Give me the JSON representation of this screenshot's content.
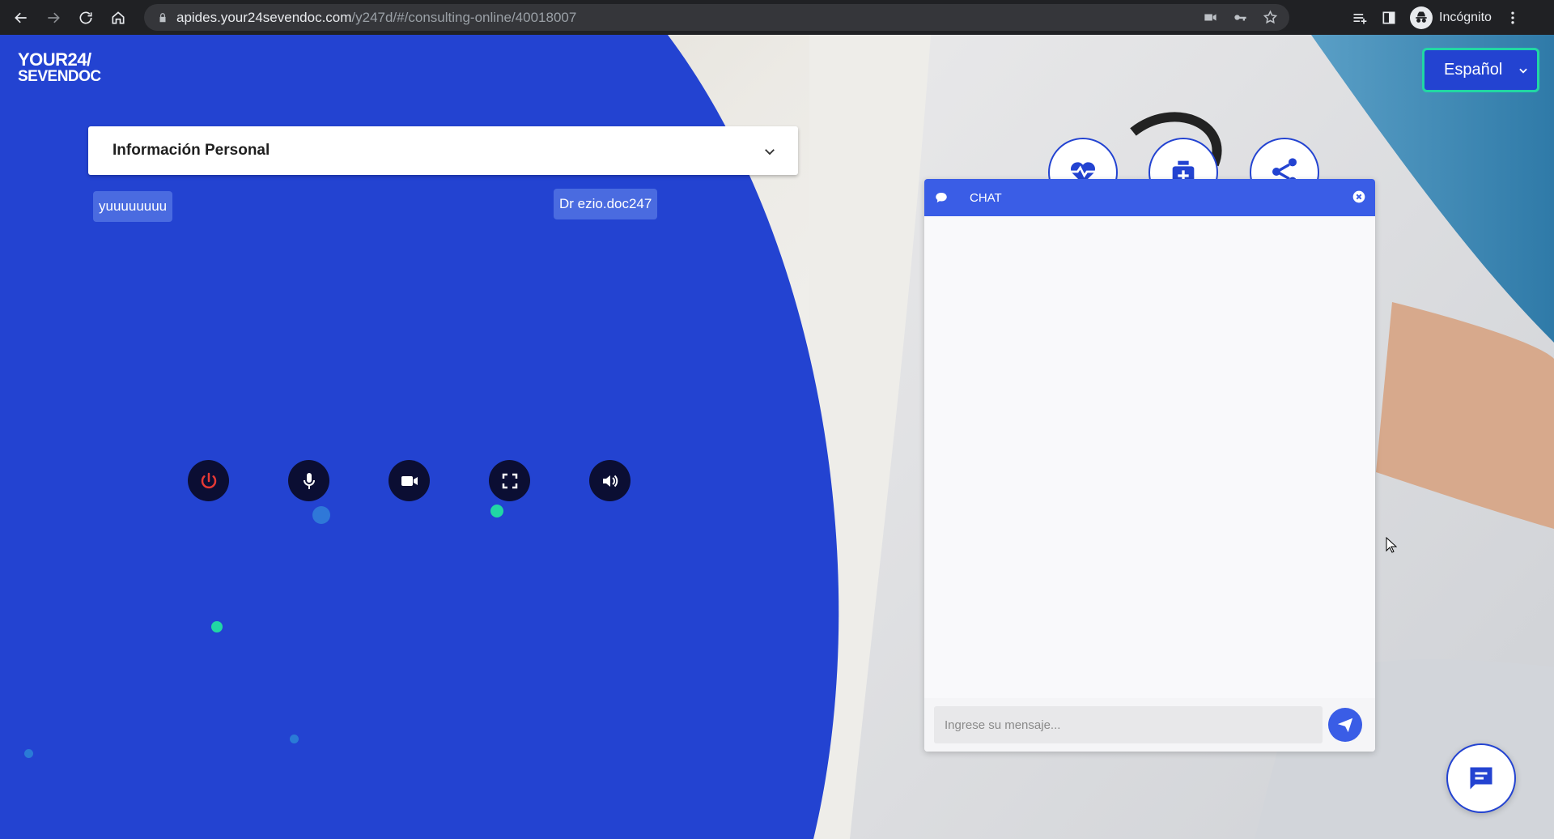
{
  "browser": {
    "url_host": "apides.your24sevendoc.com",
    "url_path": "/y247d/#/consulting-online/40018007",
    "incognito_label": "Incógnito",
    "icons": [
      "back-icon",
      "forward-icon",
      "reload-icon",
      "home-icon",
      "lock-icon",
      "camera-blocked-icon",
      "key-icon",
      "star-icon",
      "reading-list-icon",
      "side-panel-icon",
      "incognito-icon",
      "menu-icon"
    ]
  },
  "brand": {
    "logo_line1": "YOUR24/",
    "logo_line2": "SEVENDOC"
  },
  "language": {
    "selected": "Español"
  },
  "personal_info": {
    "title": "Información Personal"
  },
  "video": {
    "patient_name": "yuuuuuuuu",
    "doctor_name": "Dr ezio.doc247",
    "controls": [
      "power-icon",
      "microphone-icon",
      "video-camera-icon",
      "fullscreen-icon",
      "volume-icon"
    ]
  },
  "actions": {
    "icons": [
      "heart-monitor-icon",
      "medical-kit-icon",
      "share-icon"
    ]
  },
  "chat": {
    "title": "CHAT",
    "input_placeholder": "Ingrese su mensaje...",
    "input_value": ""
  },
  "colors": {
    "brand_blue": "#2343d1",
    "chat_header": "#3a5de6",
    "accent_green": "#21d7a4",
    "control_dark": "#0b0e33",
    "power_red": "#e53935"
  }
}
